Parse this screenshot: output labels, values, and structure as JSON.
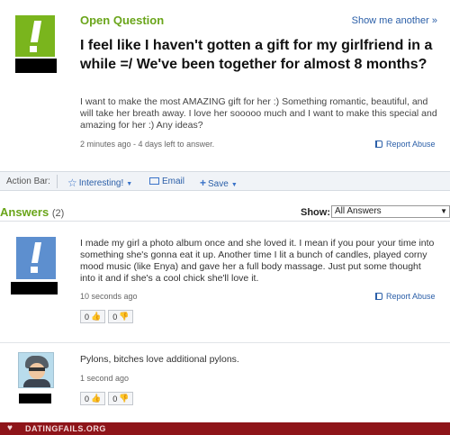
{
  "question": {
    "label": "Open Question",
    "show_another": "Show me another »",
    "title": "I feel like I haven't gotten a gift for my girlfriend in a while =/ We've been together for almost 8 months?",
    "body": "I want to make the most AMAZING gift for her :) Something romantic, beautiful, and will take her breath away. I love her sooooo much and I want to make this special and amazing for her :) Any ideas?",
    "meta": "2 minutes ago - 4 days left to answer.",
    "report": "Report Abuse"
  },
  "action_bar": {
    "label": "Action Bar:",
    "interesting": "Interesting!",
    "email": "Email",
    "save": "Save"
  },
  "answers": {
    "title": "Answers",
    "count": "(2)",
    "show_label": "Show:",
    "show_value": "All Answers",
    "items": [
      {
        "text": "I made my girl a photo album once and she loved it. I mean if you pour your time into something she's gonna eat it up. Another time I lit a bunch of candles, played corny mood music (like Enya) and gave her a full body massage. Just put some thought into it and if she's a cool chick she'll love it.",
        "time": "10 seconds ago",
        "report": "Report Abuse",
        "up": "0",
        "down": "0"
      },
      {
        "text": "Pylons, bitches love additional pylons.",
        "time": "1 second ago",
        "up": "0",
        "down": "0"
      }
    ]
  },
  "footer": {
    "site": "DATINGFAILS.ORG"
  },
  "colors": {
    "green": "#6aa51a",
    "link_blue": "#2b5fa8",
    "footer_red": "#8e1419"
  }
}
